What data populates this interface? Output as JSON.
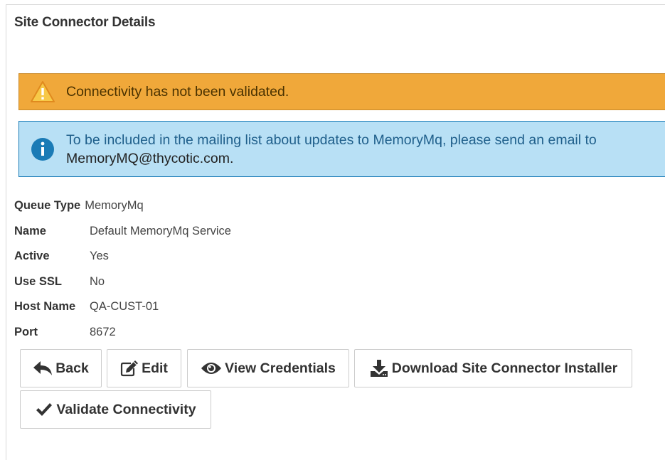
{
  "page": {
    "title": "Site Connector Details"
  },
  "alerts": {
    "warning": {
      "icon": "warning-triangle-icon",
      "text": "Connectivity has not been validated."
    },
    "info": {
      "icon": "info-circle-icon",
      "text": "To be included in the mailing list about updates to MemoryMq, please send an email to",
      "email": "MemoryMQ@thycotic.com."
    }
  },
  "details": {
    "queue_type": {
      "label": "Queue Type",
      "value": "MemoryMq"
    },
    "name": {
      "label": "Name",
      "value": "Default MemoryMq Service"
    },
    "active": {
      "label": "Active",
      "value": "Yes"
    },
    "use_ssl": {
      "label": "Use SSL",
      "value": "No"
    },
    "host_name": {
      "label": "Host Name",
      "value": "QA-CUST-01"
    },
    "port": {
      "label": "Port",
      "value": "8672"
    }
  },
  "buttons": {
    "back": {
      "label": "Back",
      "icon": "reply-arrow-icon"
    },
    "edit": {
      "label": "Edit",
      "icon": "pencil-square-icon"
    },
    "view_credentials": {
      "label": "View Credentials",
      "icon": "eye-icon"
    },
    "download_installer": {
      "label": "Download Site Connector Installer",
      "icon": "download-icon"
    },
    "validate": {
      "label": "Validate Connectivity",
      "icon": "checkmark-icon"
    }
  },
  "colors": {
    "warning_bg": "#f0a83a",
    "info_bg": "#b8e0f5",
    "info_icon": "#1a7bb6",
    "warning_icon": "#f7c948"
  }
}
